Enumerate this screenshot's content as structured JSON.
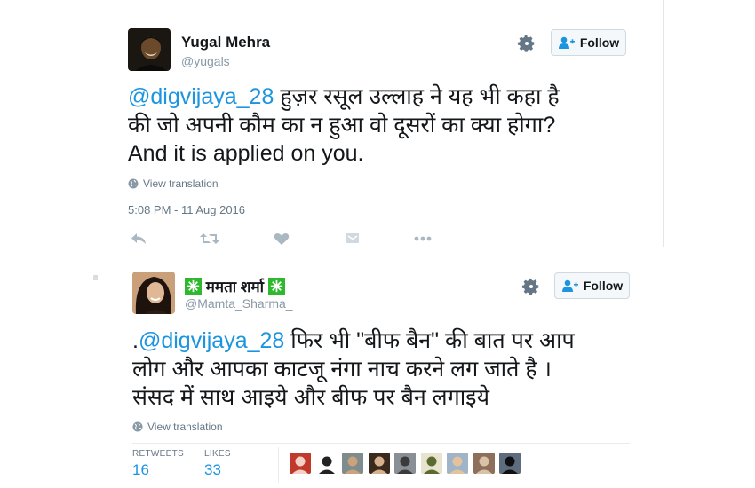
{
  "tweet1": {
    "name": "Yugal Mehra",
    "handle": "@yugals",
    "follow_label": "Follow",
    "text_mention": "@digvijaya_28",
    "text_line1_rest": " हुज़र रसूल उल्लाह ने यह भी कहा है",
    "text_line2": "की जो अपनी कौम का न हुआ वो दूसरों का क्या होगा?",
    "text_line3": "And it is applied on you.",
    "view_translation": "View translation",
    "timestamp": "5:08 PM - 11 Aug 2016",
    "actions": [
      "reply-icon",
      "retweet-icon",
      "like-icon",
      "dm-icon",
      "more-icon"
    ]
  },
  "tweet2": {
    "name": "ममता शर्मा",
    "handle": "@Mamta_Sharma_",
    "follow_label": "Follow",
    "text_prefix": ".",
    "text_mention": "@digvijaya_28",
    "text_line1_rest": " फिर भी \"बीफ बैन\" की बात पर आप",
    "text_line2": "लोग और आपका काटजू नंगा नाच करने लग जाते है ।",
    "text_line3": "संसद में साथ आइये और बीफ पर बैन लगाइये",
    "view_translation": "View translation",
    "retweets_label": "RETWEETS",
    "retweets_value": "16",
    "likes_label": "LIKES",
    "likes_value": "33",
    "liker_avatars": [
      "avatar-1",
      "avatar-2",
      "avatar-3",
      "avatar-4",
      "avatar-5",
      "avatar-6",
      "avatar-7",
      "avatar-8",
      "avatar-9"
    ]
  },
  "colors": {
    "mention": "#1b95e0",
    "text": "#14171a",
    "muted": "#657786",
    "action": "#aab8c2",
    "sparkle": "#2eb82e"
  }
}
